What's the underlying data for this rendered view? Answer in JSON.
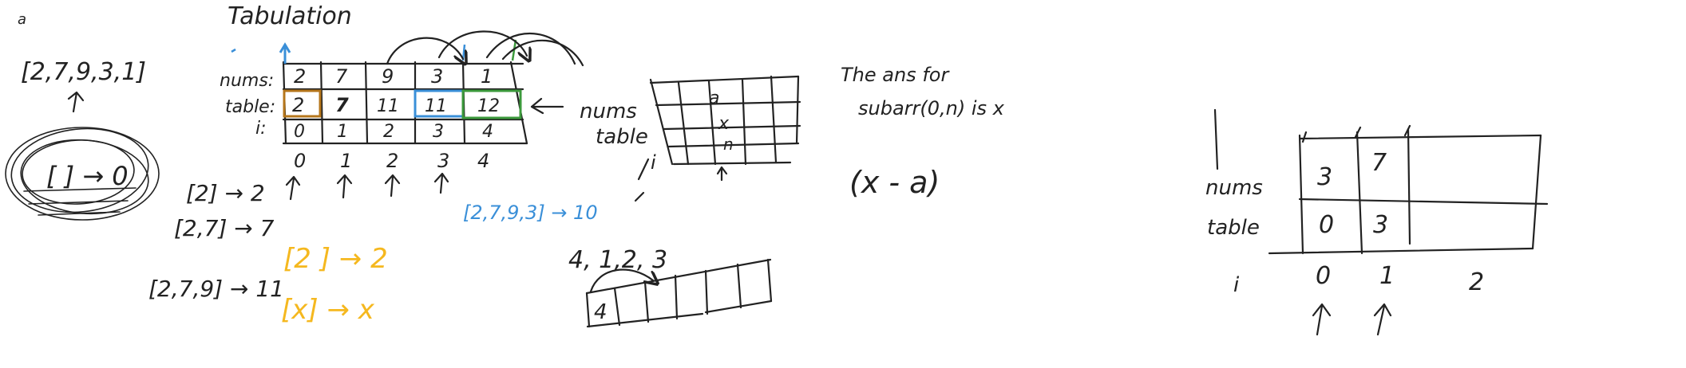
{
  "colors": {
    "ink": "#222222",
    "orange": "#f5b81f",
    "blue": "#3a8fd8",
    "green": "#3c9a3c",
    "brown": "#b5761b",
    "whiteboard": "#ffffff"
  },
  "notes": {
    "corner_mark": "a",
    "title": "Tabulation",
    "input_array": "[2,7,9,3,1]",
    "empty_case": "[ ] → 0",
    "nums_label": "nums:",
    "table_label": "table:",
    "i_label": "i:",
    "nums_values": [
      "2",
      "7",
      "9",
      "3",
      "1"
    ],
    "table_values": [
      "2",
      "7",
      "11",
      "11",
      "12"
    ],
    "index_values": [
      "0",
      "1",
      "2",
      "3",
      "4"
    ],
    "case_one": "[2] → 2",
    "case_two": "[2,7] → 7",
    "case_three": "[2,7,9] → 11",
    "blue_case": "[2,7,9,3] → 10",
    "orange_case_one": "[2 ] → 2",
    "orange_case_two": "[x] → x",
    "mid_nums": "nums",
    "mid_table": "table",
    "mid_i": "i",
    "cell_a": "a",
    "cell_x": "x",
    "cell_n": "n",
    "steps": "4, 1,2, 3",
    "step_cell": "4",
    "ans_line_one": "The ans for",
    "ans_line_two": "subarr(0,n) is x",
    "formula": "(x - a)",
    "right_nums": "nums",
    "right_table": "table",
    "right_i": "i",
    "right_nums_values": [
      "3",
      "7"
    ],
    "right_table_values": [
      "0",
      "3"
    ],
    "right_index_values": [
      "0",
      "1",
      "2"
    ]
  }
}
